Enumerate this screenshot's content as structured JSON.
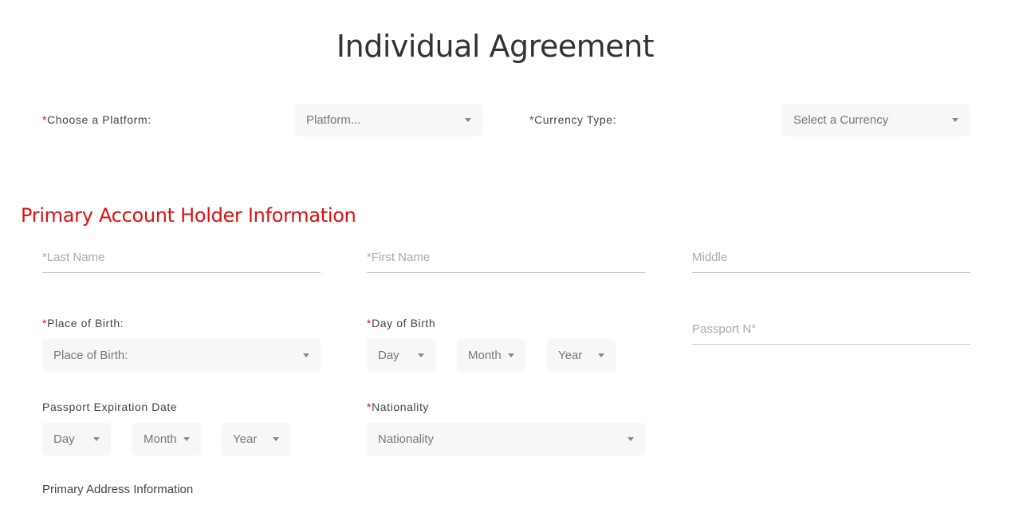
{
  "page": {
    "title": "Individual Agreement"
  },
  "platform": {
    "label": "Choose a Platform:",
    "required_mark": "*",
    "selected": "Platform..."
  },
  "currency": {
    "label": "Currency Type:",
    "required_mark": "*",
    "selected": "Select a Currency"
  },
  "primary_section": {
    "title": "Primary Account Holder Information",
    "last_name_placeholder": "*Last Name",
    "first_name_placeholder": "*First Name",
    "middle_placeholder": "Middle",
    "place_of_birth": {
      "label": "Place of Birth:",
      "required_mark": "*",
      "selected": "Place of Birth:"
    },
    "day_of_birth": {
      "label": "Day of Birth",
      "required_mark": "*",
      "day": "Day",
      "month": "Month",
      "year": "Year"
    },
    "passport_placeholder": "Passport N°",
    "passport_expiration": {
      "label": "Passport Expiration Date",
      "day": "Day",
      "month": "Month",
      "year": "Year"
    },
    "nationality": {
      "label": "Nationality",
      "required_mark": "*",
      "selected": "Nationality"
    }
  },
  "address_section": {
    "title": "Primary Address Information"
  },
  "colors": {
    "accent_red": "#e01010",
    "field_bg": "#f6f7f8",
    "underline": "#c9c9c9"
  }
}
